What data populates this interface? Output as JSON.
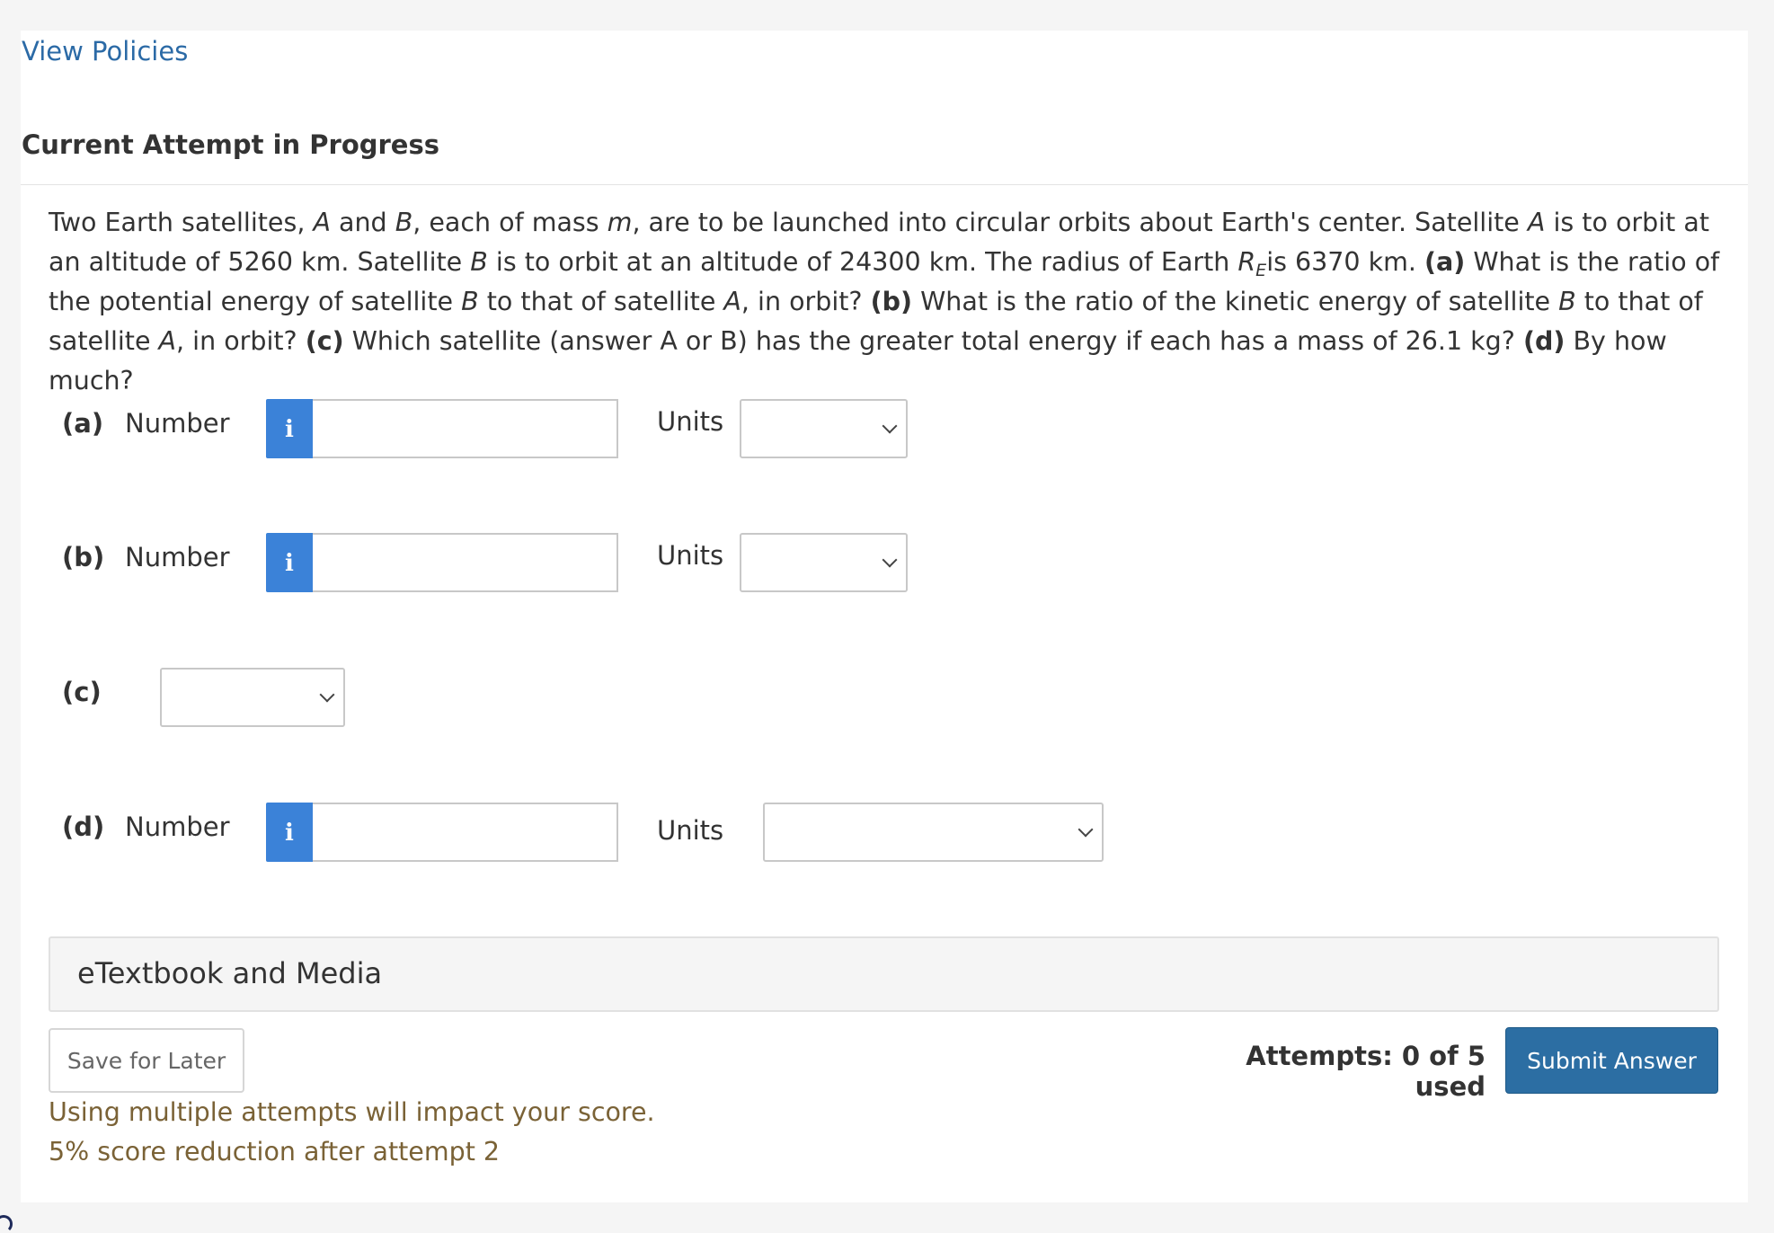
{
  "header": {
    "view_policies": "View Policies",
    "attempt_title": "Current Attempt in Progress"
  },
  "question": {
    "s1": "Two Earth satellites, ",
    "A1": "A",
    "s2": " and ",
    "B1": "B",
    "s3": ", each of mass ",
    "m": "m",
    "s4": ", are to be launched into circular orbits about Earth's center. Satellite ",
    "A2": "A",
    "s5": " is to orbit at an altitude of 5260 km. Satellite ",
    "B2": "B",
    "s6": " is to orbit at an altitude of 24300 km. The radius of Earth ",
    "R": "R",
    "E": "E",
    "s7": "is 6370 km. ",
    "qa_label": "(a)",
    "qa_text": " What is the ratio of the potential energy of satellite ",
    "B3": "B",
    "s8": " to that of satellite ",
    "A3": "A",
    "s9": ", in orbit? ",
    "qb_label": "(b)",
    "qb_text": " What is the ratio of the kinetic energy of satellite ",
    "B4": "B",
    "s10": " to that of satellite ",
    "A4": "A",
    "s11": ", in orbit? ",
    "qc_label": "(c)",
    "qc_text": " Which satellite (answer A or B) has the greater total energy if each has a mass of 26.1 kg? ",
    "qd_label": "(d)",
    "qd_text": " By how much?"
  },
  "parts": {
    "a": {
      "label": "(a)",
      "number_label": "Number",
      "info_icon": "i",
      "value": "",
      "units_label": "Units",
      "units_value": ""
    },
    "b": {
      "label": "(b)",
      "number_label": "Number",
      "info_icon": "i",
      "value": "",
      "units_label": "Units",
      "units_value": ""
    },
    "c": {
      "label": "(c)",
      "select_value": ""
    },
    "d": {
      "label": "(d)",
      "number_label": "Number",
      "info_icon": "i",
      "value": "",
      "units_label": "Units",
      "units_value": ""
    }
  },
  "etextbook": {
    "label": "eTextbook and Media"
  },
  "footer": {
    "save_label": "Save for Later",
    "attempts_text": "Attempts: 0 of 5 used",
    "submit_label": "Submit Answer",
    "warning_line1": "Using multiple attempts will impact your score.",
    "warning_line2": "5% score reduction after attempt 2"
  },
  "colors": {
    "link": "#2b6aa6",
    "info_button": "#3b82d8",
    "submit_button": "#2c6ea3",
    "warning_text": "#7a6236"
  }
}
